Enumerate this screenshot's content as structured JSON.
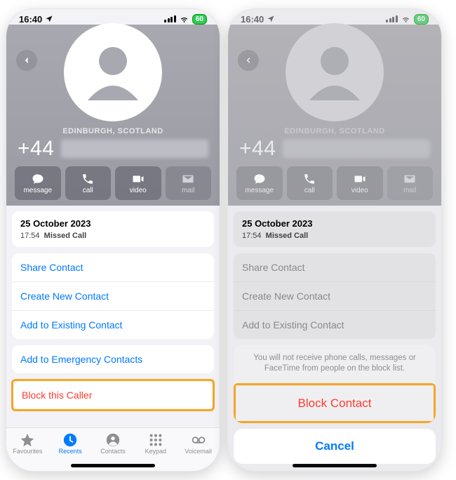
{
  "status": {
    "time": "16:40",
    "battery": "60"
  },
  "contact": {
    "location": "EDINBURGH, SCOTLAND",
    "country_code": "+44"
  },
  "actions": {
    "message": "message",
    "call": "call",
    "video": "video",
    "mail": "mail"
  },
  "history": {
    "date": "25 October 2023",
    "time": "17:54",
    "type": "Missed Call"
  },
  "menu": {
    "share": "Share Contact",
    "create": "Create New Contact",
    "add_existing": "Add to Existing Contact",
    "emergency": "Add to Emergency Contacts",
    "block": "Block this Caller"
  },
  "tabs": {
    "favourites": "Favourites",
    "recents": "Recents",
    "contacts": "Contacts",
    "keypad": "Keypad",
    "voicemail": "Voicemail"
  },
  "sheet": {
    "message": "You will not receive phone calls, messages or FaceTime from people on the block list.",
    "block": "Block Contact",
    "cancel": "Cancel"
  }
}
